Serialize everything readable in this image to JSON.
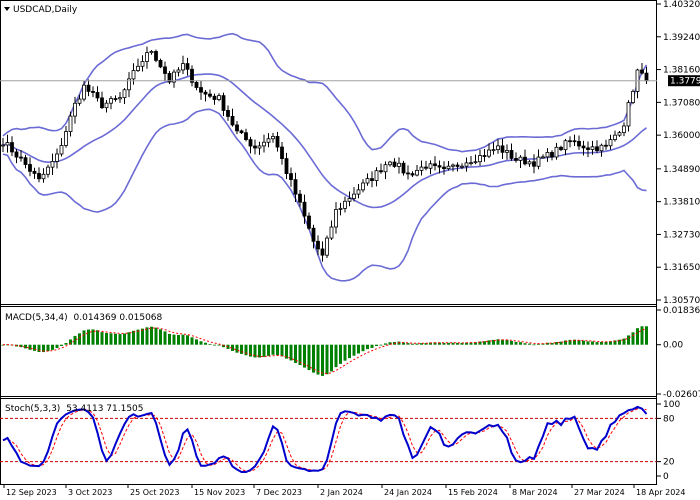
{
  "chart_data": [
    {
      "type": "candlestick",
      "title": "USDCAD,Daily",
      "price_ticks": [
        "1.40320",
        "1.39240",
        "1.38160",
        "1.37080",
        "1.36000",
        "1.34890",
        "1.33810",
        "1.32730",
        "1.31650",
        "1.30570"
      ],
      "current_price": "1.37793",
      "ylim": [
        1.3057,
        1.4032
      ],
      "indicator": "Bollinger Bands",
      "colors": {
        "bands": "#6b6bd6",
        "candle": "#000000",
        "grid": "#c0c0c0"
      },
      "x_ticks": [
        "12 Sep 2023",
        "3 Oct 2023",
        "25 Oct 2023",
        "15 Nov 2023",
        "7 Dec 2023",
        "2 Jan 2024",
        "24 Jan 2024",
        "15 Feb 2024",
        "8 Mar 2024",
        "27 Mar 2024",
        "18 Apr 2024"
      ],
      "anchors": [
        {
          "i": 0,
          "p": 1.358
        },
        {
          "i": 4,
          "p": 1.352
        },
        {
          "i": 8,
          "p": 1.345
        },
        {
          "i": 12,
          "p": 1.353
        },
        {
          "i": 16,
          "p": 1.37
        },
        {
          "i": 18,
          "p": 1.376
        },
        {
          "i": 22,
          "p": 1.37
        },
        {
          "i": 26,
          "p": 1.372
        },
        {
          "i": 30,
          "p": 1.383
        },
        {
          "i": 33,
          "p": 1.388
        },
        {
          "i": 37,
          "p": 1.378
        },
        {
          "i": 40,
          "p": 1.383
        },
        {
          "i": 44,
          "p": 1.374
        },
        {
          "i": 48,
          "p": 1.372
        },
        {
          "i": 52,
          "p": 1.361
        },
        {
          "i": 56,
          "p": 1.356
        },
        {
          "i": 60,
          "p": 1.36
        },
        {
          "i": 63,
          "p": 1.348
        },
        {
          "i": 66,
          "p": 1.337
        },
        {
          "i": 69,
          "p": 1.325
        },
        {
          "i": 71,
          "p": 1.32
        },
        {
          "i": 74,
          "p": 1.335
        },
        {
          "i": 78,
          "p": 1.341
        },
        {
          "i": 82,
          "p": 1.346
        },
        {
          "i": 86,
          "p": 1.352
        },
        {
          "i": 90,
          "p": 1.347
        },
        {
          "i": 94,
          "p": 1.35
        },
        {
          "i": 98,
          "p": 1.348
        },
        {
          "i": 102,
          "p": 1.351
        },
        {
          "i": 106,
          "p": 1.353
        },
        {
          "i": 110,
          "p": 1.356
        },
        {
          "i": 114,
          "p": 1.352
        },
        {
          "i": 118,
          "p": 1.351
        },
        {
          "i": 122,
          "p": 1.354
        },
        {
          "i": 126,
          "p": 1.358
        },
        {
          "i": 130,
          "p": 1.356
        },
        {
          "i": 134,
          "p": 1.356
        },
        {
          "i": 138,
          "p": 1.364
        },
        {
          "i": 141,
          "p": 1.381
        },
        {
          "i": 143,
          "p": 1.3779
        }
      ]
    },
    {
      "type": "bar",
      "title": "MACD(5,34,4)",
      "values_label": "0.014369 0.015068",
      "y_ticks": [
        "0.018367",
        "0.00",
        "-0.026076"
      ],
      "ylim": [
        -0.026076,
        0.018367
      ],
      "colors": {
        "histogram": "#008000",
        "signal": "#ff0000"
      }
    },
    {
      "type": "line",
      "title": "Stoch(5,3,3)",
      "values_label": "53.4113 71.1505",
      "y_ticks": [
        "100",
        "80",
        "20",
        "0"
      ],
      "ylim": [
        0,
        100
      ],
      "levels": [
        80,
        20
      ],
      "colors": {
        "main": "#0000cc",
        "signal": "#ff0000",
        "levels": "#cc0000"
      }
    }
  ]
}
